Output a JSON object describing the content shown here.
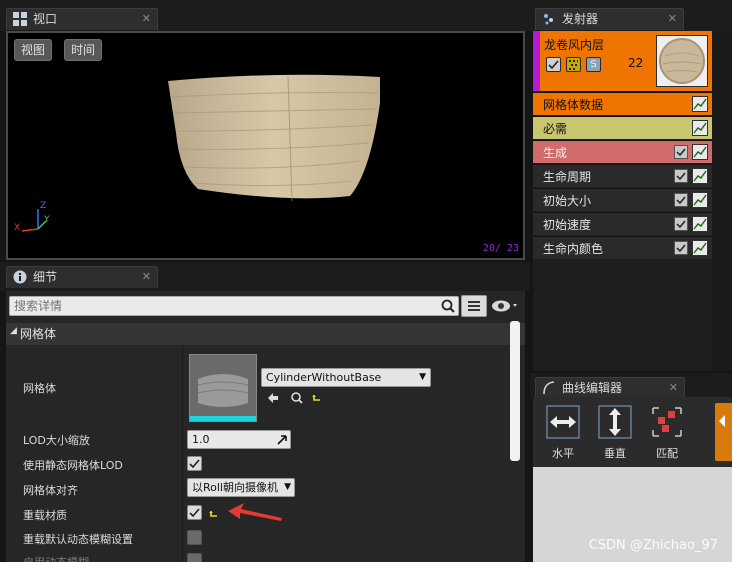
{
  "viewport_tab": {
    "title": "视口",
    "close": "✕"
  },
  "viewport": {
    "view_button": "视图",
    "time_button": "时间",
    "frame_counter": "20/ 23",
    "axis": {
      "x": "X",
      "y": "Y",
      "z": "Z"
    }
  },
  "emitter_tab": {
    "title": "发射器",
    "close": "✕"
  },
  "emitter": {
    "name": "龙卷风内层",
    "count": "22",
    "modules": [
      {
        "label": "网格体数据",
        "has_checkbox": false
      },
      {
        "label": "必需",
        "has_checkbox": false
      },
      {
        "label": "生成",
        "has_checkbox": true
      },
      {
        "label": "生命周期",
        "has_checkbox": true
      },
      {
        "label": "初始大小",
        "has_checkbox": true
      },
      {
        "label": "初始速度",
        "has_checkbox": true
      },
      {
        "label": "生命内颜色",
        "has_checkbox": true
      }
    ]
  },
  "details_tab": {
    "title": "细节",
    "close": "✕"
  },
  "details": {
    "search_placeholder": "搜索详情",
    "category": "网格体",
    "mesh_label": "网格体",
    "mesh_value": "CylinderWithoutBase",
    "properties": [
      {
        "label": "LOD大小缩放",
        "value": "1.0"
      },
      {
        "label": "使用静态网格体LOD",
        "value": ""
      },
      {
        "label": "网格体对齐",
        "value": "以Roll朝向摄像机"
      },
      {
        "label": "重载材质",
        "value": ""
      },
      {
        "label": "重载默认动态模糊设置",
        "value": ""
      },
      {
        "label": "启用动态模糊",
        "value": ""
      }
    ]
  },
  "curve_tab": {
    "title": "曲线编辑器",
    "close": "✕"
  },
  "curve_tools": [
    {
      "label": "水平"
    },
    {
      "label": "垂直"
    },
    {
      "label": "匹配"
    }
  ],
  "watermark": "CSDN @Zhichao_97",
  "colors": {
    "emitter_header": "#f07400",
    "emitter_accent": "#b31bd6",
    "module_mesh": "#f07400",
    "module_required": "#c9c670",
    "module_spawn": "#d06b6b",
    "module_default": "#2a2a2a",
    "annotation_arrow": "#e53935"
  }
}
